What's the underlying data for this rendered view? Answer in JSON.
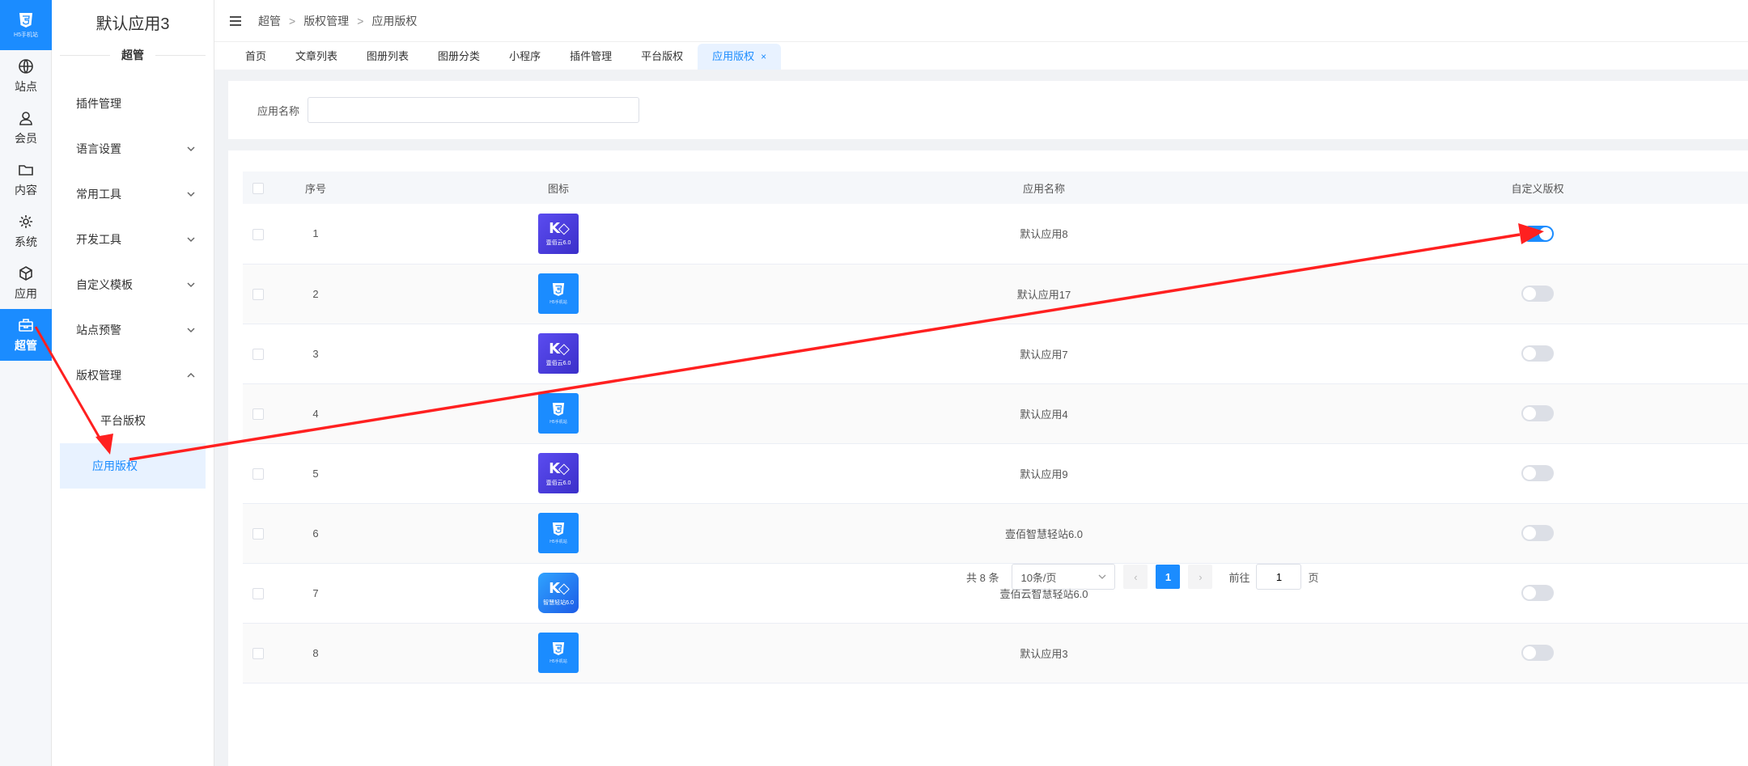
{
  "rail": {
    "logo_text": "H5手机站",
    "items": [
      {
        "label": "站点",
        "icon": "globe-icon"
      },
      {
        "label": "会员",
        "icon": "user-icon"
      },
      {
        "label": "内容",
        "icon": "folder-icon"
      },
      {
        "label": "系统",
        "icon": "gear-icon"
      },
      {
        "label": "应用",
        "icon": "cube-icon"
      },
      {
        "label": "超管",
        "icon": "toolbox-icon",
        "active": true
      }
    ]
  },
  "sidebar": {
    "title": "默认应用3",
    "section": "超管",
    "items": [
      {
        "label": "插件管理"
      },
      {
        "label": "语言设置"
      },
      {
        "label": "常用工具"
      },
      {
        "label": "开发工具"
      },
      {
        "label": "自定义模板"
      },
      {
        "label": "站点预警"
      },
      {
        "label": "版权管理"
      }
    ],
    "sub_items": [
      {
        "label": "平台版权"
      },
      {
        "label": "应用版权",
        "active": true
      }
    ]
  },
  "breadcrumb": [
    "超管",
    "版权管理",
    "应用版权"
  ],
  "tabs": [
    "首页",
    "文章列表",
    "图册列表",
    "图册分类",
    "小程序",
    "插件管理",
    "平台版权",
    "应用版权"
  ],
  "tab_close": "×",
  "search": {
    "label": "应用名称",
    "value": ""
  },
  "table": {
    "headers": {
      "no": "序号",
      "icon": "图标",
      "name": "应用名称",
      "custom": "自定义版权"
    },
    "rows": [
      {
        "no": "1",
        "icon": "k",
        "name": "默认应用8",
        "on": true
      },
      {
        "no": "2",
        "icon": "h5",
        "name": "默认应用17",
        "on": false
      },
      {
        "no": "3",
        "icon": "k",
        "name": "默认应用7",
        "on": false
      },
      {
        "no": "4",
        "icon": "h5",
        "name": "默认应用4",
        "on": false
      },
      {
        "no": "5",
        "icon": "k",
        "name": "默认应用9",
        "on": false
      },
      {
        "no": "6",
        "icon": "h5",
        "name": "壹佰智慧轻站6.0",
        "on": false
      },
      {
        "no": "7",
        "icon": "k2",
        "name": "壹佰云智慧轻站6.0",
        "on": false
      },
      {
        "no": "8",
        "icon": "h5",
        "name": "默认应用3",
        "on": false
      }
    ],
    "icon_texts": {
      "h5": "H5手机站",
      "k": "壹佰云6.0",
      "k2": "智慧轻站6.0"
    }
  },
  "pagination": {
    "total": "共 8 条",
    "page_size": "10条/页",
    "current": "1",
    "goto_label": "前往",
    "goto_value": "1",
    "page_suffix": "页"
  },
  "colors": {
    "accent": "#1b8cff",
    "arrow": "#ff2020"
  }
}
